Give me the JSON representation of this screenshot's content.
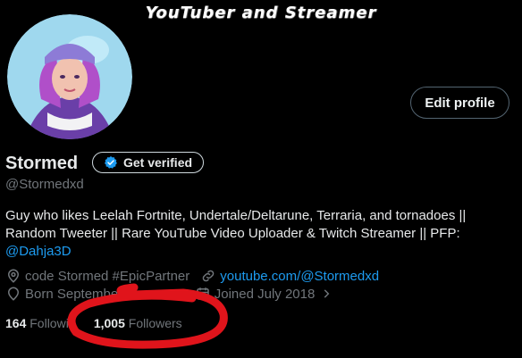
{
  "banner": {
    "title": "YouTuber and Streamer"
  },
  "profile": {
    "name": "Stormed",
    "handle": "@Stormedxd",
    "edit_label": "Edit profile",
    "verify_label": "Get verified",
    "bio_text": "Guy who likes Leelah Fortnite, Undertale/Deltarune, Terraria, and tornadoes || Random Tweeter || Rare YouTube Video Uploader & Twitch Streamer || PFP: ",
    "bio_mention": "@Dahja3D",
    "creator_code": "code Stormed #EpicPartner",
    "website": "youtube.com/@Stormedxd",
    "born": "Born September 1",
    "joined": "Joined July 2018",
    "following_count": "164",
    "following_label": "Followi",
    "followers_count": "1,005",
    "followers_label": "Followers"
  },
  "colors": {
    "accent": "#1d9bf0",
    "muted": "#71767b",
    "annotation": "#e0141b"
  }
}
